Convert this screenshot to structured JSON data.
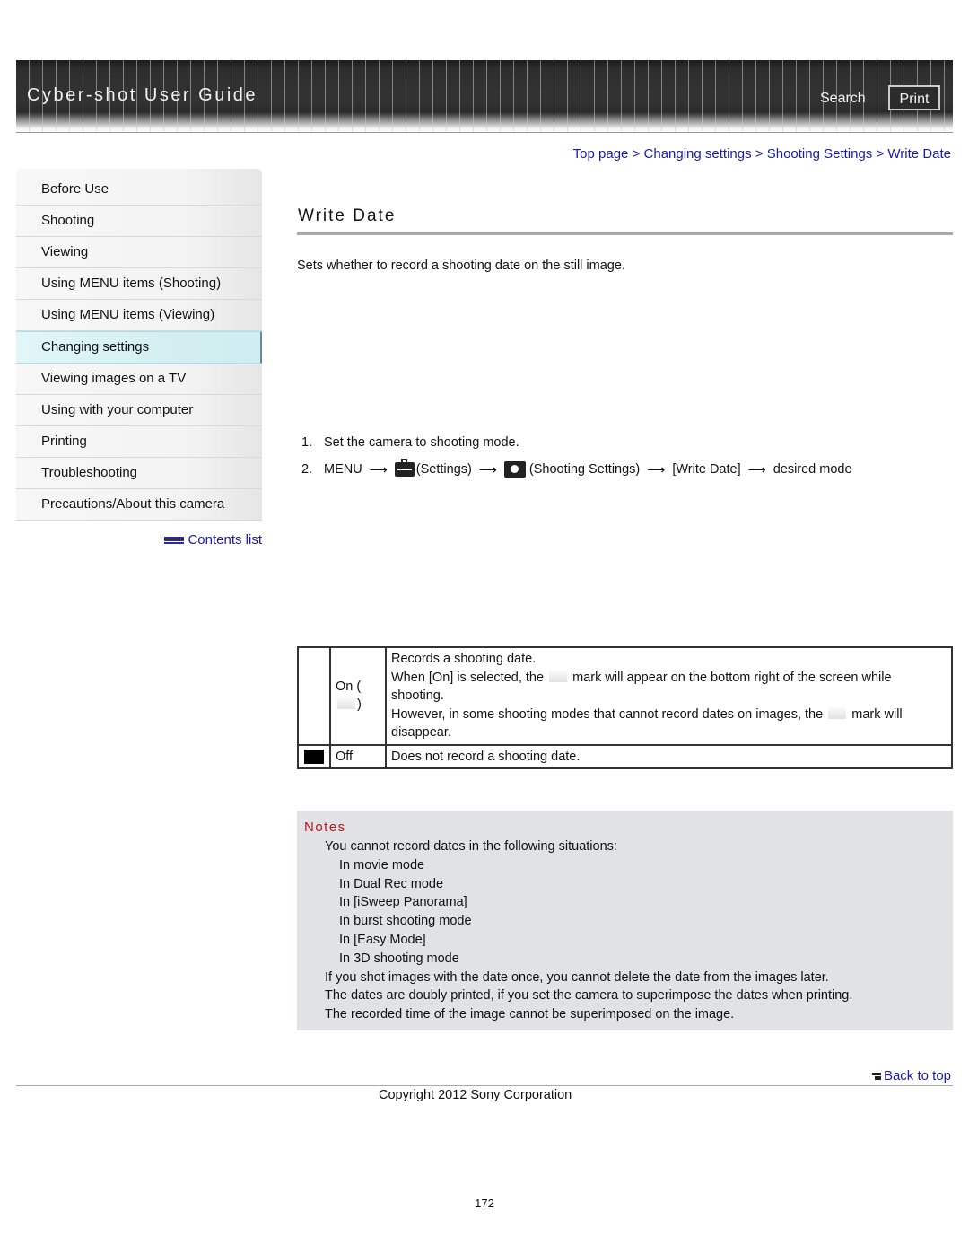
{
  "header": {
    "title": "Cyber-shot User Guide",
    "search_label": "Search",
    "print_label": "Print"
  },
  "sidebar": {
    "items": [
      {
        "label": "Before Use",
        "active": false
      },
      {
        "label": "Shooting",
        "active": false
      },
      {
        "label": "Viewing",
        "active": false
      },
      {
        "label": "Using MENU items (Shooting)",
        "active": false
      },
      {
        "label": "Using MENU items (Viewing)",
        "active": false
      },
      {
        "label": "Changing settings",
        "active": true
      },
      {
        "label": "Viewing images on a TV",
        "active": false
      },
      {
        "label": "Using with your computer",
        "active": false
      },
      {
        "label": "Printing",
        "active": false
      },
      {
        "label": "Troubleshooting",
        "active": false
      },
      {
        "label": "Precautions/About this camera",
        "active": false
      }
    ],
    "contents_list_label": "Contents list"
  },
  "breadcrumb": {
    "items": [
      "Top page",
      "Changing settings",
      "Shooting Settings",
      "Write Date"
    ],
    "separator": ">"
  },
  "main": {
    "title": "Write Date",
    "intro": "Sets whether to record a shooting date on the still image.",
    "steps": {
      "step1": {
        "num": "1.",
        "text": "Set the camera to shooting mode."
      },
      "step2": {
        "num": "2.",
        "menu": "MENU",
        "settings": "(Settings)",
        "shooting_settings": "(Shooting Settings)",
        "write_date": "[Write Date]",
        "desired": "desired mode"
      },
      "arrow": "⟶"
    },
    "options": {
      "on": {
        "name_prefix": "On (",
        "name_suffix": ")",
        "line1": "Records a shooting date.",
        "line2a": "When [On] is selected, the",
        "line2b": "mark will appear on the bottom right of the screen while shooting.",
        "line3a": "However, in some shooting modes that cannot record dates on images, the",
        "line3b": "mark will disappear."
      },
      "off": {
        "name": "Off",
        "description": "Does not record a shooting date."
      }
    },
    "notes": {
      "title": "Notes",
      "intro": "You cannot record dates in the following situations:",
      "situations": [
        "In movie mode",
        "In Dual Rec mode",
        "In [iSweep Panorama]",
        "In burst shooting mode",
        "In [Easy Mode]",
        "In 3D shooting mode"
      ],
      "items": [
        "If you shot images with the date once, you cannot delete the date from the images later.",
        "The dates are doubly printed, if you set the camera to superimpose the dates when printing.",
        "The recorded time of the image cannot be superimposed on the image."
      ]
    }
  },
  "footer": {
    "back_to_top": "Back to top",
    "copyright": "Copyright 2012 Sony Corporation",
    "page_number": "172"
  },
  "colors": {
    "link": "#1a1aa6",
    "notes_title": "#c0151a",
    "notes_bg": "#e0e2e6",
    "active_nav": "#d2eef0"
  }
}
